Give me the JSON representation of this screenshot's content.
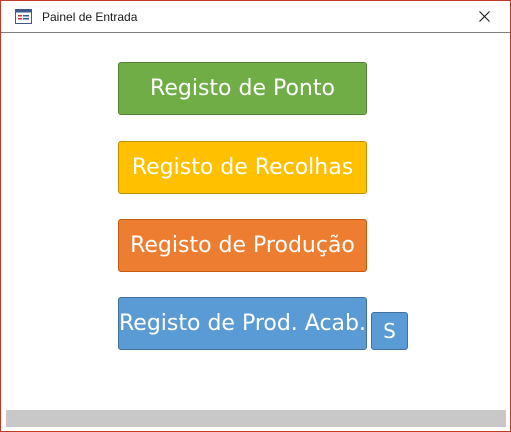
{
  "window": {
    "title": "Painel de Entrada",
    "icon": "form-icon",
    "close_icon": "close-icon"
  },
  "buttons": {
    "ponto": {
      "label": "Registo de Ponto",
      "color": "#70ad47"
    },
    "recolhas": {
      "label": "Registo de Recolhas",
      "color": "#ffc000"
    },
    "producao": {
      "label": "Registo de Produção",
      "color": "#ed7d31"
    },
    "acabado": {
      "label": "Registo de Prod. Acab.",
      "color": "#5b9bd5"
    },
    "s": {
      "label": "S",
      "color": "#5b9bd5"
    }
  },
  "accent": {
    "border": "#c0392b"
  }
}
